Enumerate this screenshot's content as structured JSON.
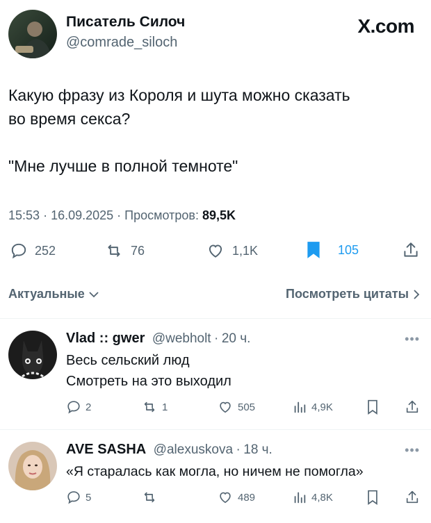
{
  "brand": {
    "name": "X.com"
  },
  "tweet": {
    "author": "Писатель Силоч",
    "handle": "@comrade_siloch",
    "text": "Какую фразу из Короля и шута можно сказать\nво время секса?\n\n\"Мне лучше в полной темноте\"",
    "time": "15:53",
    "date": "16.09.2025",
    "views_label": "Просмотров:",
    "views": "89,5K",
    "actions": {
      "replies": "252",
      "retweets": "76",
      "likes": "1,1K",
      "bookmarks": "105"
    },
    "bookmark_color": "#1d9bf0"
  },
  "sort": {
    "label": "Актуальные",
    "quotes_label": "Посмотреть цитаты"
  },
  "replies": [
    {
      "name": "Vlad :: gwer",
      "handle": "@webholt",
      "time": "20 ч.",
      "text": "Весь сельский люд\nСмотреть на это выходил",
      "actions": {
        "replies": "2",
        "retweets": "1",
        "likes": "505",
        "views": "4,9K"
      }
    },
    {
      "name": "AVE SASHA",
      "handle": "@alexuskova",
      "time": "18 ч.",
      "text": "«Я старалась как могла, но ничем не помогла»",
      "actions": {
        "replies": "5",
        "retweets": "",
        "likes": "489",
        "views": "4,8K"
      }
    }
  ]
}
